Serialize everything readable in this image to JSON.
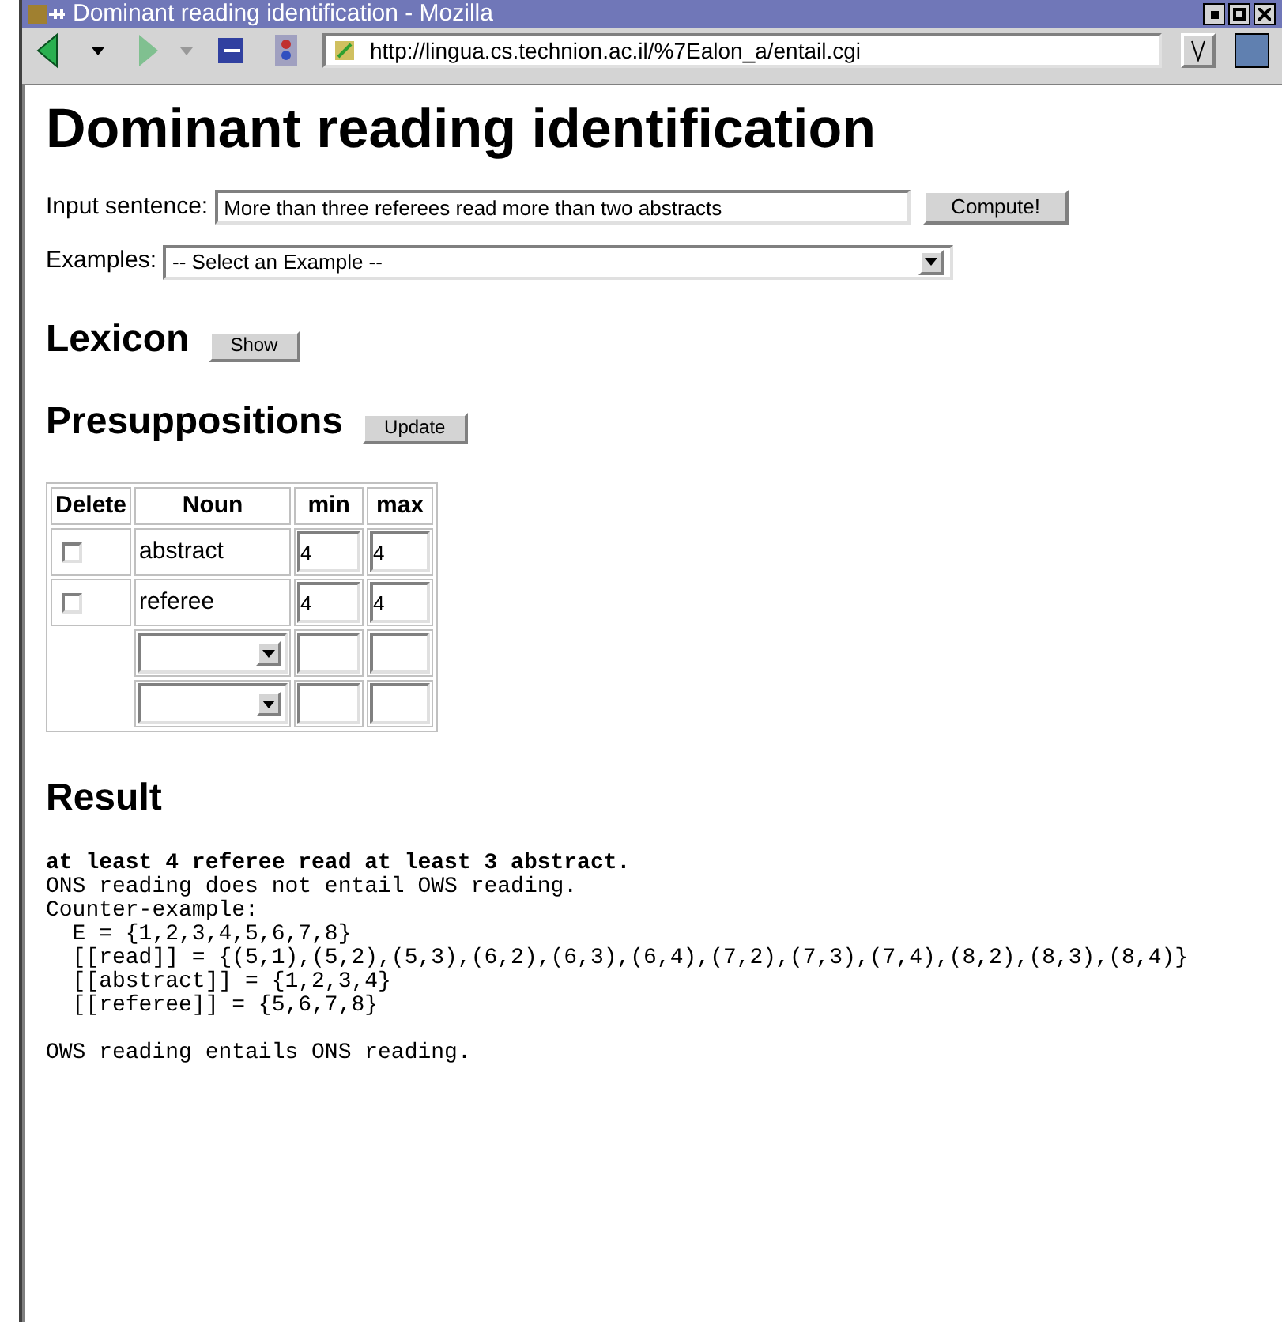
{
  "window": {
    "title": "Dominant reading identification - Mozilla"
  },
  "toolbar": {
    "url": "http://lingua.cs.technion.ac.il/%7Ealon_a/entail.cgi"
  },
  "page": {
    "heading": "Dominant reading identification",
    "input": {
      "label": "Input sentence:",
      "value": "More than three referees read more than two abstracts",
      "button": "Compute!"
    },
    "examples": {
      "label": "Examples:",
      "value": "-- Select an Example --"
    },
    "lexicon": {
      "heading": "Lexicon",
      "button": "Show"
    },
    "presuppositions": {
      "heading": "Presuppositions",
      "button": "Update",
      "columns": [
        "Delete",
        "Noun",
        "min",
        "max"
      ],
      "rows": [
        {
          "kind": "entry",
          "checked": false,
          "noun": "abstract",
          "min": "4",
          "max": "4"
        },
        {
          "kind": "entry",
          "checked": false,
          "noun": "referee",
          "min": "4",
          "max": "4"
        },
        {
          "kind": "new"
        },
        {
          "kind": "new"
        }
      ]
    },
    "result": {
      "heading": "Result",
      "lines": [
        {
          "kind": "bold",
          "text": "at least 4 referee read at least 3 abstract."
        },
        {
          "kind": "plain",
          "text": "ONS reading does not entail OWS reading."
        },
        {
          "kind": "plain",
          "text": "Counter-example:"
        },
        {
          "kind": "plain",
          "text": "  E = {1,2,3,4,5,6,7,8}"
        },
        {
          "kind": "plain",
          "text": "  [[read]] = {(5,1),(5,2),(5,3),(6,2),(6,3),(6,4),(7,2),(7,3),(7,4),(8,2),(8,3),(8,4)}"
        },
        {
          "kind": "plain",
          "text": "  [[abstract]] = {1,2,3,4}"
        },
        {
          "kind": "plain",
          "text": "  [[referee]] = {5,6,7,8}"
        },
        {
          "kind": "blank"
        },
        {
          "kind": "plain",
          "text": "OWS reading entails ONS reading."
        }
      ]
    }
  }
}
